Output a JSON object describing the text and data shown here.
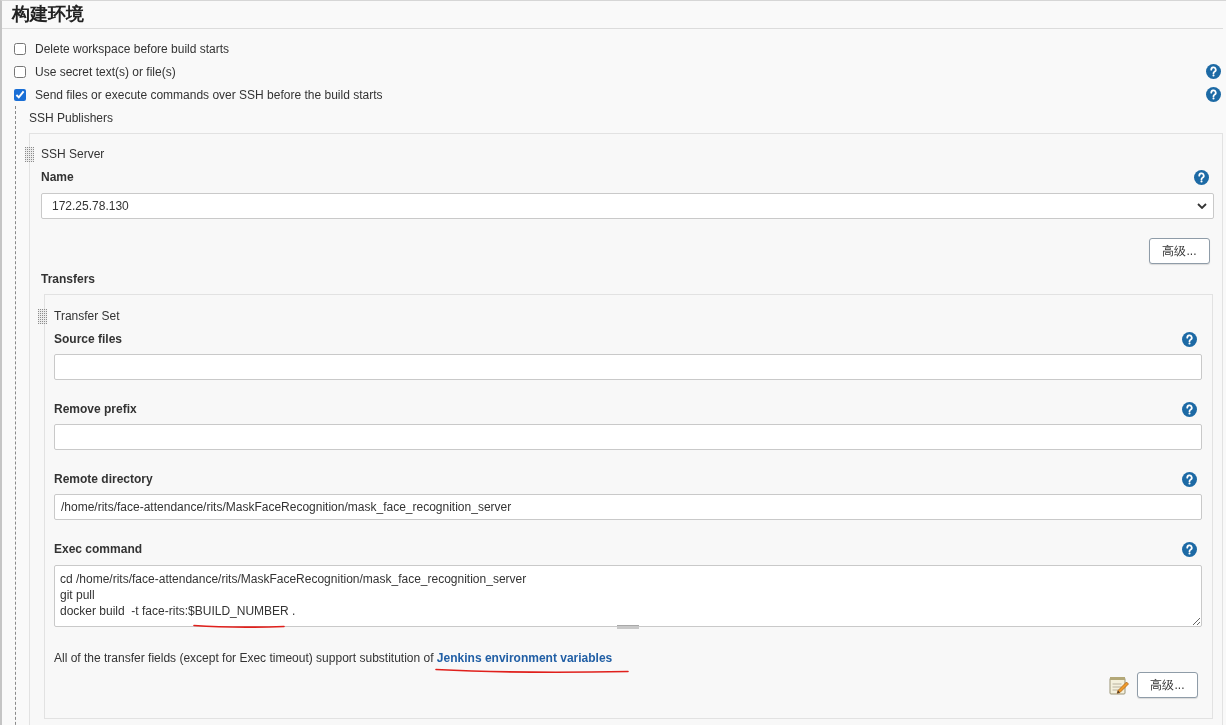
{
  "section_title": "构建环境",
  "options": [
    {
      "label": "Delete workspace before build starts",
      "checked": false,
      "help": false
    },
    {
      "label": "Use secret text(s) or file(s)",
      "checked": false,
      "help": true
    },
    {
      "label": "Send files or execute commands over SSH before the build starts",
      "checked": true,
      "help": true
    }
  ],
  "ssh_publishers": {
    "title": "SSH Publishers",
    "server": {
      "title": "SSH Server",
      "name_field": {
        "label": "Name",
        "value": "172.25.78.130",
        "help": true
      },
      "advanced_button": "高级...",
      "transfers_label": "Transfers",
      "transfer_set": {
        "title": "Transfer Set",
        "fields": [
          {
            "label": "Source files",
            "kind": "input",
            "help": true
          },
          {
            "label": "Remove prefix",
            "kind": "input",
            "help": true
          },
          {
            "label": "Remote directory",
            "kind": "input",
            "value": "/home/rits/face-attendance/rits/MaskFaceRecognition/mask_face_recognition_server",
            "help": true
          },
          {
            "label": "Exec command",
            "kind": "textarea",
            "lines": [
              "cd /home/rits/face-attendance/rits/MaskFaceRecognition/mask_face_recognition_server",
              "git pull",
              "docker build  -t face-rits:$BUILD_NUMBER ."
            ],
            "help": true
          }
        ],
        "note": {
          "text": "All of the transfer fields (except for Exec timeout) support substitution of",
          "link": "Jenkins environment variables"
        },
        "advanced_button": "高级..."
      }
    }
  }
}
